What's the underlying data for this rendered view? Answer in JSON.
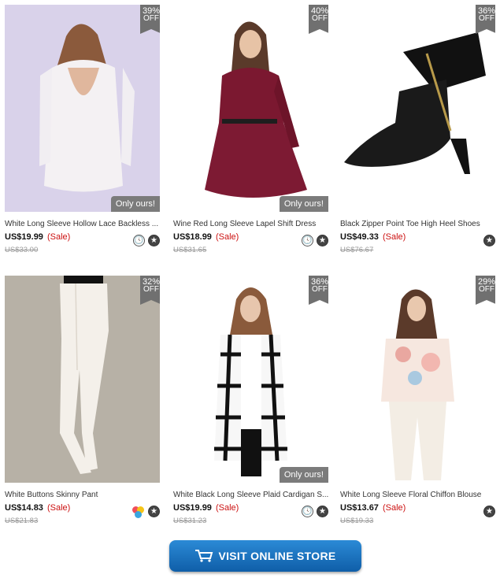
{
  "products": [
    {
      "title": "White Long Sleeve Hollow Lace Backless ...",
      "price": "US$19.99",
      "sale": "(Sale)",
      "old_price": "US$33.00",
      "discount": "39%",
      "off": "OFF",
      "badge": "Only ours!",
      "icons": [
        "clock-icon",
        "star-icon"
      ]
    },
    {
      "title": "Wine Red Long Sleeve Lapel Shift Dress",
      "price": "US$18.99",
      "sale": "(Sale)",
      "old_price": "US$31.65",
      "discount": "40%",
      "off": "OFF",
      "badge": "Only ours!",
      "icons": [
        "clock-icon",
        "star-icon"
      ]
    },
    {
      "title": "Black Zipper Point Toe High Heel Shoes",
      "price": "US$49.33",
      "sale": "(Sale)",
      "old_price": "US$76.67",
      "discount": "36%",
      "off": "OFF",
      "badge": "",
      "icons": [
        "star-icon"
      ]
    },
    {
      "title": "White Buttons Skinny Pant",
      "price": "US$14.83",
      "sale": "(Sale)",
      "old_price": "US$21.83",
      "discount": "32%",
      "off": "OFF",
      "badge": "",
      "icons": [
        "color-swatch-icon",
        "star-icon"
      ]
    },
    {
      "title": "White Black Long Sleeve Plaid Cardigan S...",
      "price": "US$19.99",
      "sale": "(Sale)",
      "old_price": "US$31.23",
      "discount": "36%",
      "off": "OFF",
      "badge": "Only ours!",
      "icons": [
        "clock-icon",
        "star-icon"
      ]
    },
    {
      "title": "White Long Sleeve Floral Chiffon Blouse",
      "price": "US$13.67",
      "sale": "(Sale)",
      "old_price": "US$19.33",
      "discount": "29%",
      "off": "OFF",
      "badge": "",
      "icons": [
        "star-icon"
      ]
    }
  ],
  "store_button": {
    "label": "VISIT ONLINE STORE",
    "icon": "shopping-cart-icon"
  },
  "colors": {
    "accent": "#1a73c4",
    "sale": "#cc1111",
    "badge": "#707070"
  }
}
